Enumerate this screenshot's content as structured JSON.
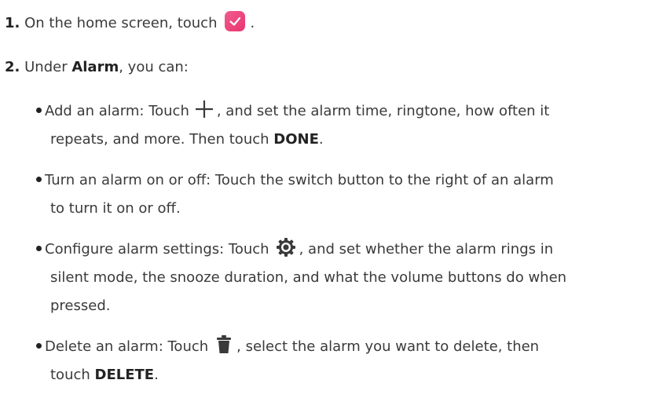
{
  "steps": [
    {
      "number": "1.",
      "text_before_icon": "On the home screen, touch",
      "icon": "clock-app-icon",
      "text_after_icon": "."
    },
    {
      "number": "2.",
      "text_before": "Under ",
      "bold": "Alarm",
      "text_after": ", you can:"
    }
  ],
  "bullets": {
    "add": {
      "lead": "Add an alarm: Touch",
      "icon": "plus-icon",
      "line1_rest": ", and set the alarm time, ringtone, how often it",
      "line2_start": "repeats, and more. Then touch ",
      "line2_bold": "DONE",
      "line2_end": "."
    },
    "toggle": {
      "line1": "Turn an alarm on or off: Touch the switch button to the right of an alarm",
      "line2": "to turn it on or off."
    },
    "settings": {
      "lead": "Configure alarm settings: Touch",
      "icon": "gear-icon",
      "line1_rest": ", and set whether the alarm rings in",
      "line2": "silent mode, the snooze duration, and what the volume buttons do when",
      "line3": "pressed."
    },
    "delete": {
      "lead": "Delete an alarm: Touch",
      "icon": "trash-icon",
      "line1_rest": ", select the alarm you want to delete, then",
      "line2_start": "touch ",
      "line2_bold": "DELETE",
      "line2_end": "."
    }
  },
  "colors": {
    "text": "#3a3a3a",
    "bold_text": "#222222",
    "clock_icon_pink": "#e8356f"
  }
}
